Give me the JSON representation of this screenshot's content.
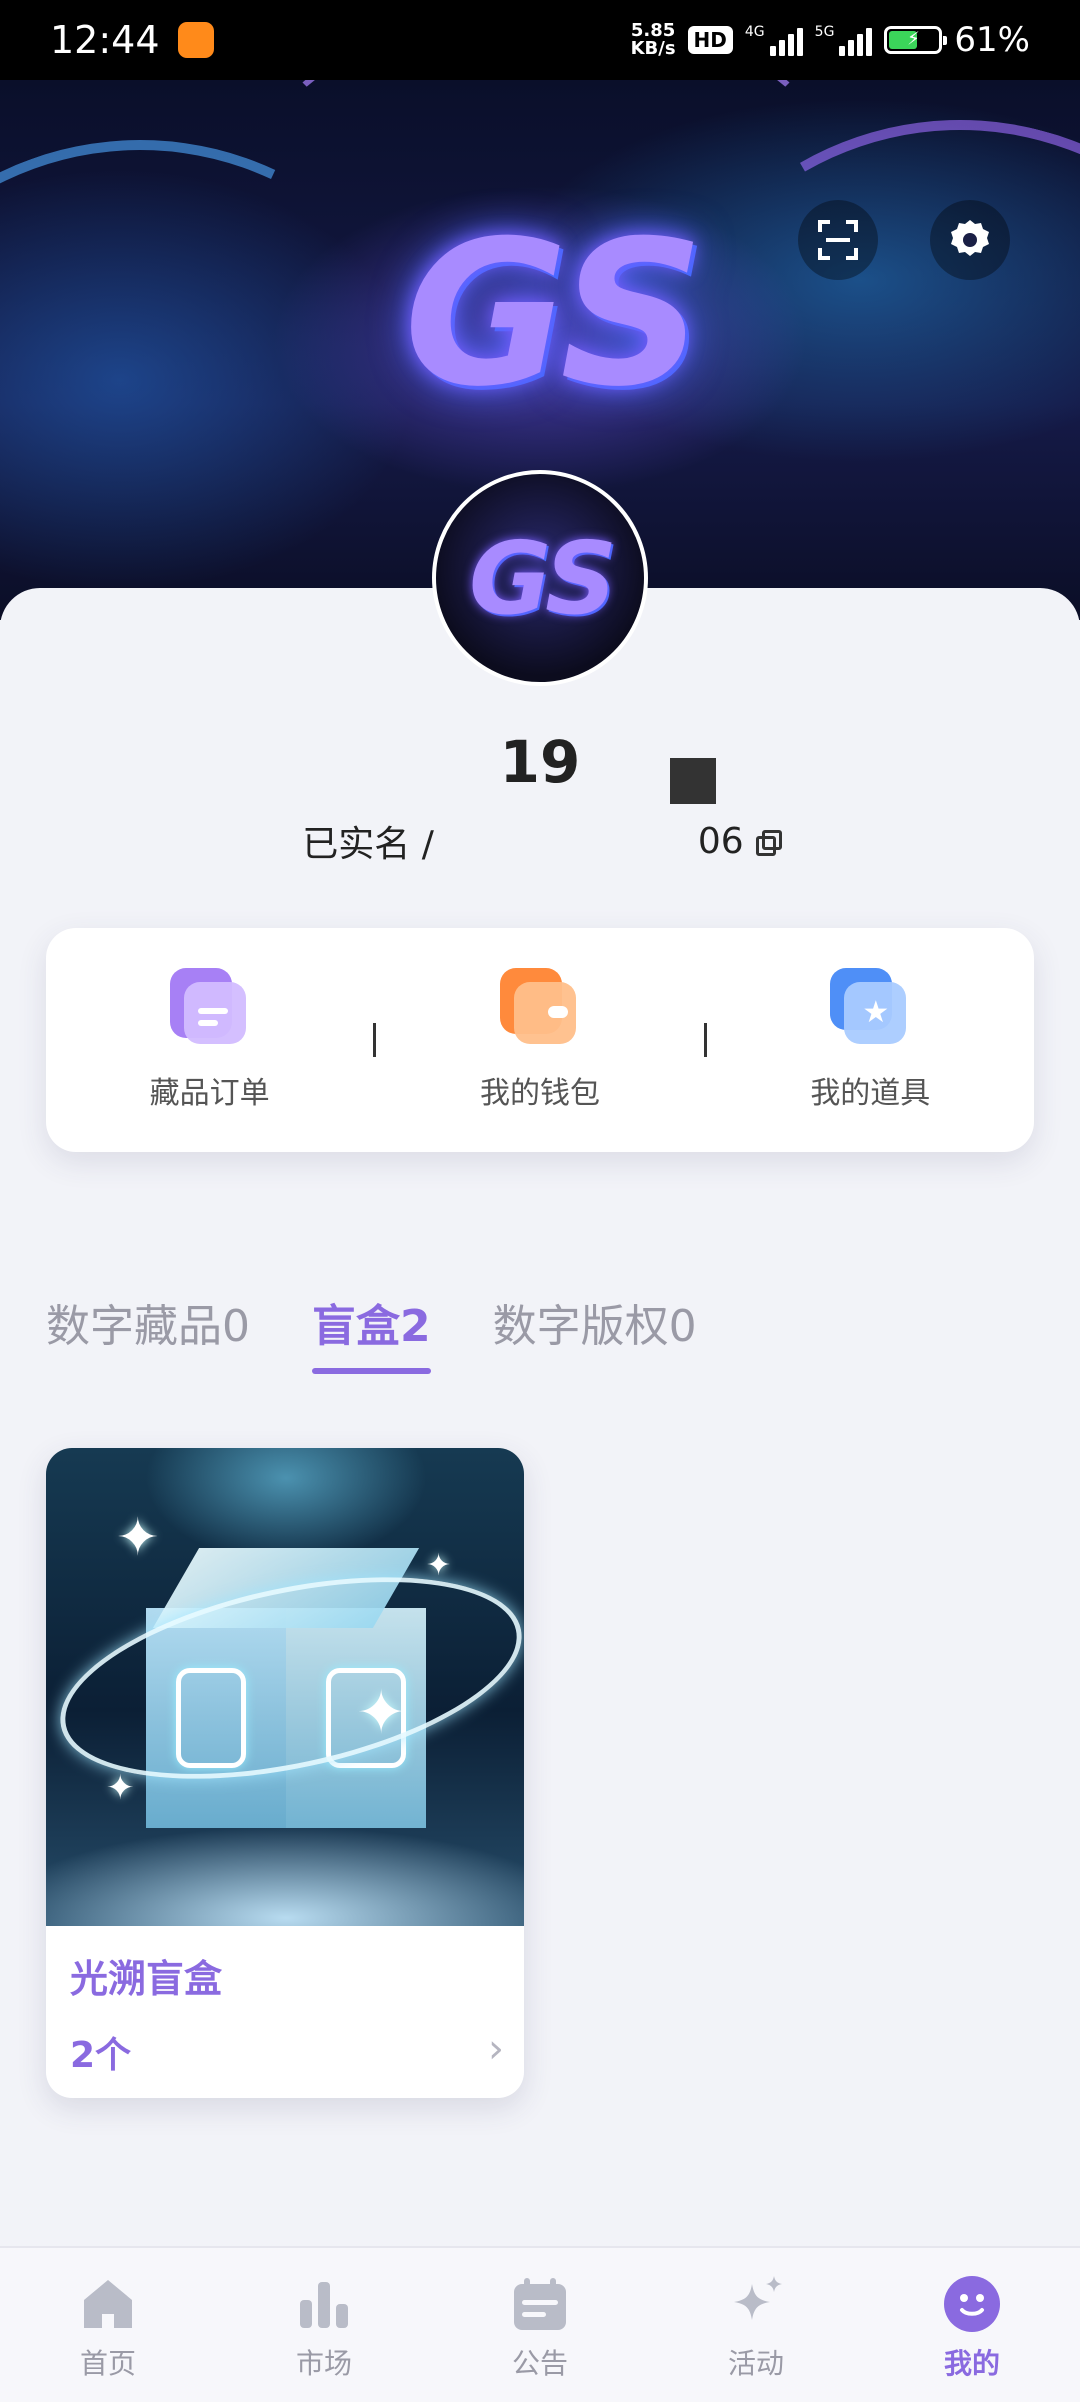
{
  "status_bar": {
    "time": "12:44",
    "net_speed_value": "5.85",
    "net_speed_unit": "KB/s",
    "hd_label": "HD",
    "sim1_label": "4G",
    "sim2_label": "5G",
    "battery_percent": 61,
    "battery_text": "61%",
    "battery_color": "#3bd55a"
  },
  "profile": {
    "name": "19",
    "verification": "已实名 /",
    "id_suffix": "06"
  },
  "quick_actions": [
    {
      "label": "藏品订单",
      "icon": "order-icon"
    },
    {
      "label": "我的钱包",
      "icon": "wallet-icon"
    },
    {
      "label": "我的道具",
      "icon": "props-icon"
    }
  ],
  "tabs": [
    {
      "label": "数字藏品0"
    },
    {
      "label": "盲盒2"
    },
    {
      "label": "数字版权0"
    }
  ],
  "active_tab": "盲盒2",
  "blind_box": {
    "title": "光溯盲盒",
    "count": "2个"
  },
  "bottom_nav": [
    {
      "label": "首页",
      "icon": "home-icon"
    },
    {
      "label": "市场",
      "icon": "market-icon"
    },
    {
      "label": "公告",
      "icon": "notice-icon"
    },
    {
      "label": "活动",
      "icon": "sparkle-icon"
    },
    {
      "label": "我的",
      "icon": "profile-icon"
    }
  ],
  "active_nav": "我的",
  "brand": {
    "logo_text": "GS",
    "accent_color": "#8a6ae0"
  }
}
